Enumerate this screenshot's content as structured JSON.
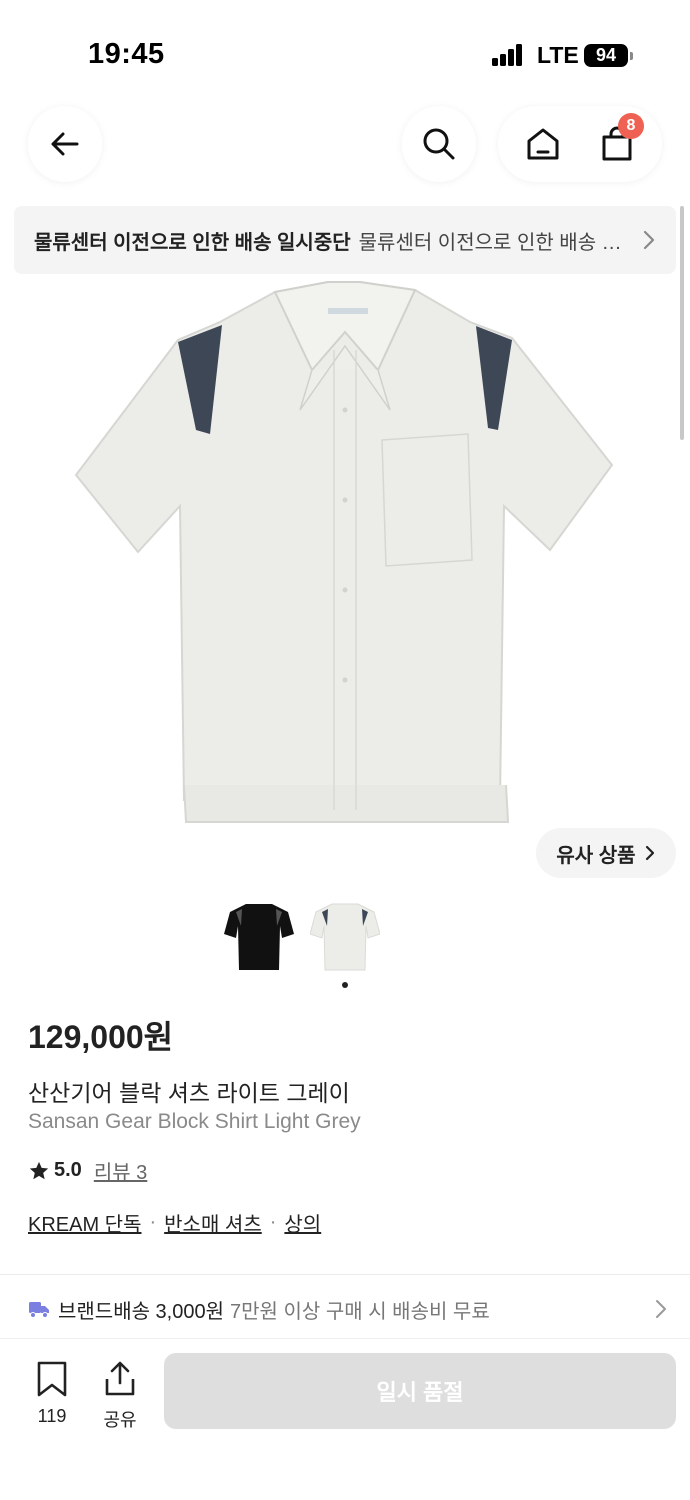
{
  "status_bar": {
    "time": "19:45",
    "network": "LTE",
    "battery": "94"
  },
  "nav": {
    "back_icon": "arrow-left-icon",
    "search_icon": "search-icon",
    "home_icon": "home-icon",
    "cart_icon": "shopping-bag-icon",
    "cart_badge": "8"
  },
  "notice": {
    "bold": "물류센터 이전으로 인한 배송 일시중단",
    "rest": "물류센터 이전으로 인한 배송 일시중단 안내"
  },
  "similar_products_label": "유사 상품",
  "product": {
    "price": "129,000원",
    "name_ko": "산산기어 블락 셔츠 라이트 그레이",
    "name_en": "Sansan Gear Block Shirt Light Grey",
    "rating": "5.0",
    "review_label": "리뷰 3",
    "tags": [
      "KREAM 단독",
      "반소매 셔츠",
      "상의"
    ],
    "tag_separator": "·",
    "shirt_color": "#ecece9",
    "accent_color": "#3d4756"
  },
  "shipping": {
    "icon": "truck-icon",
    "label": "브랜드배송 3,000원",
    "desc": "7만원 이상 구매 시 배송비 무료"
  },
  "bottom": {
    "bookmark_count": "119",
    "share_label": "공유",
    "soldout_label": "일시 품절"
  }
}
